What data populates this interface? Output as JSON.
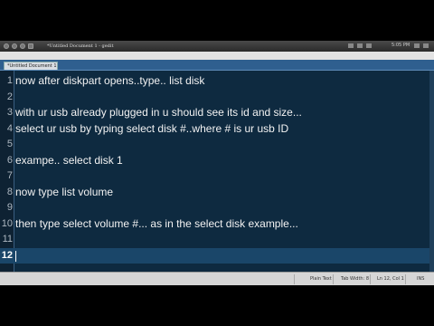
{
  "window": {
    "title": "*Untitled Document 1 - gedit"
  },
  "system_tray": {
    "clock": "5:05 PM"
  },
  "tabs": [
    {
      "label": "*Untitled Document 1"
    }
  ],
  "editor": {
    "lines": [
      {
        "number": "1",
        "text": "now after diskpart opens..type.. list disk"
      },
      {
        "number": "2",
        "text": ""
      },
      {
        "number": "3",
        "text": "with ur usb already plugged in u should see its id and size..."
      },
      {
        "number": "4",
        "text": "select ur usb by typing select disk #..where # is ur usb ID"
      },
      {
        "number": "5",
        "text": ""
      },
      {
        "number": "6",
        "text": "exampe.. select disk 1"
      },
      {
        "number": "7",
        "text": ""
      },
      {
        "number": "8",
        "text": "now type list volume"
      },
      {
        "number": "9",
        "text": ""
      },
      {
        "number": "10",
        "text": "then type select volume #... as in the select disk example..."
      },
      {
        "number": "11",
        "text": ""
      },
      {
        "number": "12",
        "text": ""
      }
    ],
    "current_line": 12
  },
  "statusbar": {
    "language": "Plain Text",
    "tab_width": "Tab Width: 8",
    "position": "Ln 12, Col 1",
    "mode": "INS"
  }
}
